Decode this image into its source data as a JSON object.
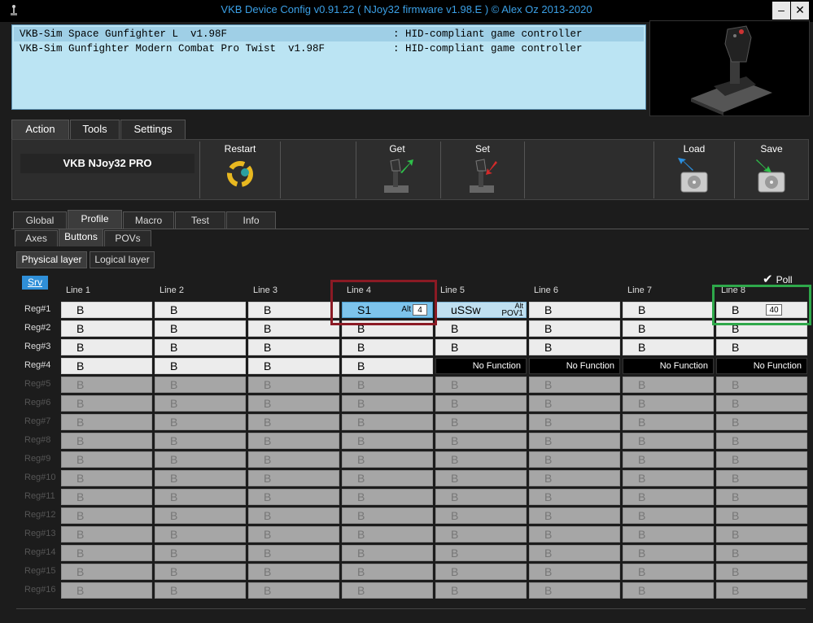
{
  "window": {
    "title": "VKB Device Config v0.91.22 ( NJoy32 firmware v1.98.E ) © Alex Oz 2013-2020",
    "min_symbol": "–",
    "close_symbol": "✕"
  },
  "devices": [
    {
      "name": "VKB-Sim Space Gunfighter L  v1.98F",
      "type": ": HID-compliant game controller"
    },
    {
      "name": "VKB-Sim Gunfighter Modern Combat Pro Twist  v1.98F",
      "type": ": HID-compliant game controller"
    }
  ],
  "main_tabs": [
    "Action",
    "Tools",
    "Settings"
  ],
  "toolbar": {
    "device_name": "VKB NJoy32 PRO",
    "restart": "Restart",
    "get": "Get",
    "set": "Set",
    "load": "Load",
    "save": "Save"
  },
  "profile_tabs": [
    "Global",
    "Profile",
    "Macro",
    "Test",
    "Info"
  ],
  "sub_tabs": [
    "Axes",
    "Buttons",
    "POVs"
  ],
  "layer_tabs": [
    "Physical layer",
    "Logical layer"
  ],
  "srv_label": "Srv",
  "poll_label": "Poll",
  "columns": [
    "Line 1",
    "Line 2",
    "Line 3",
    "Line 4",
    "Line 5",
    "Line 6",
    "Line 7",
    "Line 8"
  ],
  "rows": [
    "Reg#1",
    "Reg#2",
    "Reg#3",
    "Reg#4",
    "Reg#5",
    "Reg#6",
    "Reg#7",
    "Reg#8",
    "Reg#9",
    "Reg#10",
    "Reg#11",
    "Reg#12",
    "Reg#13",
    "Reg#14",
    "Reg#15",
    "Reg#16"
  ],
  "cells": {
    "default": "B",
    "no_function": "No Function",
    "line4_reg1": {
      "main": "S1",
      "alt": "Alt",
      "num": "4"
    },
    "line5_reg1": {
      "main": "uSSw",
      "alt": "Alt",
      "pov": "POV1"
    },
    "line8_reg1": {
      "main": "B",
      "num": "40"
    }
  },
  "colors": {
    "accent": "#3ba0e6",
    "selected_cell": "#7dc4ec",
    "highlight_red": "#8b1a24",
    "highlight_green": "#2ea84a"
  }
}
